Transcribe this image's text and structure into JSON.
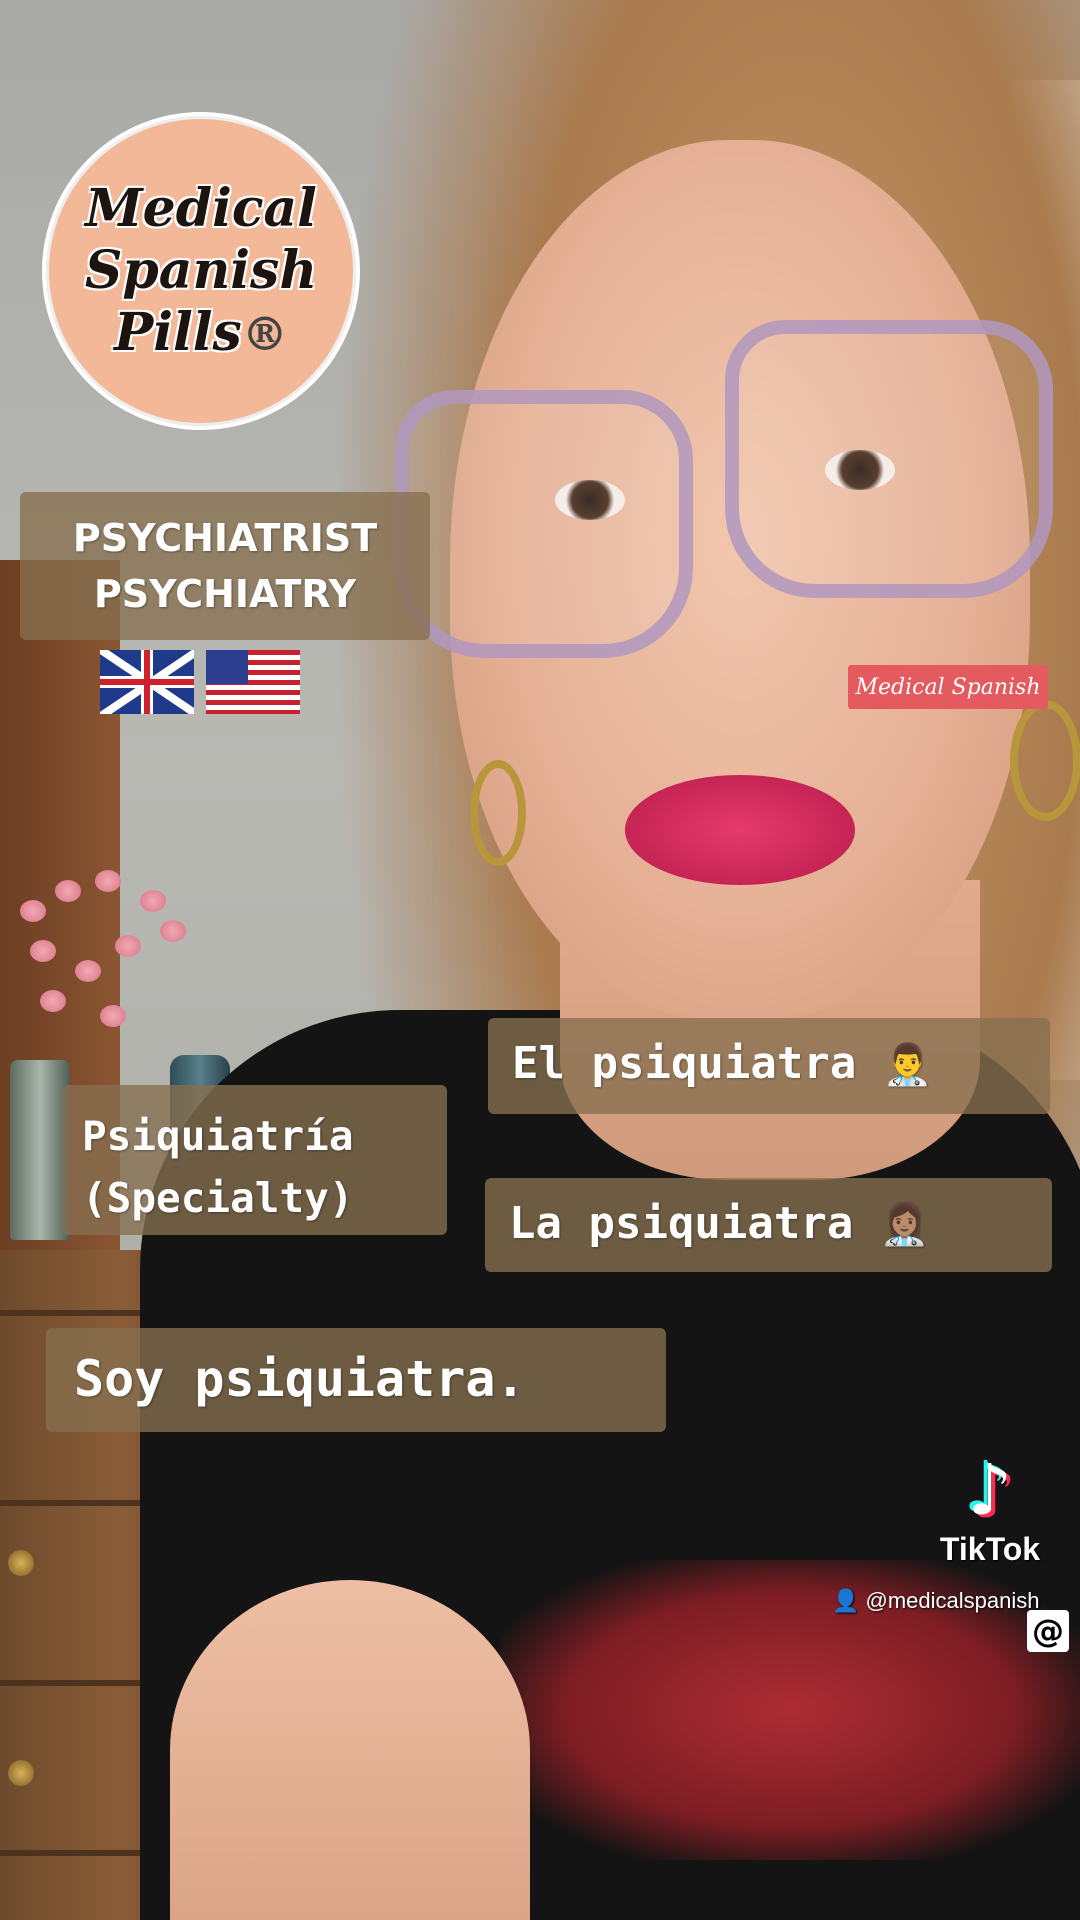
{
  "logo": {
    "line1": "Medical",
    "line2": "Spanish",
    "line3": "Pills",
    "reg_mark": "®"
  },
  "captions": {
    "english_line1": "PSYCHIATRIST",
    "english_line2": "PSYCHIATRY",
    "specialty_line1": "Psiquiatría",
    "specialty_line2": "(Specialty)",
    "male": "El psiquiatra",
    "female": "La psiquiatra",
    "sentence": "Soy psiquiatra."
  },
  "emoji": {
    "male": "👨‍⚕️",
    "female": "👩🏽‍⚕️"
  },
  "flags": [
    "uk-flag",
    "us-flag"
  ],
  "badge": {
    "label": "Medical Spanish"
  },
  "tiktok": {
    "wordmark": "TikTok",
    "handle": "@medicalspanish",
    "at_symbol": "@"
  },
  "colors": {
    "caption_bg": "#86704f",
    "logo_bg": "#f3b898",
    "badge_bg": "#e45a5e"
  }
}
